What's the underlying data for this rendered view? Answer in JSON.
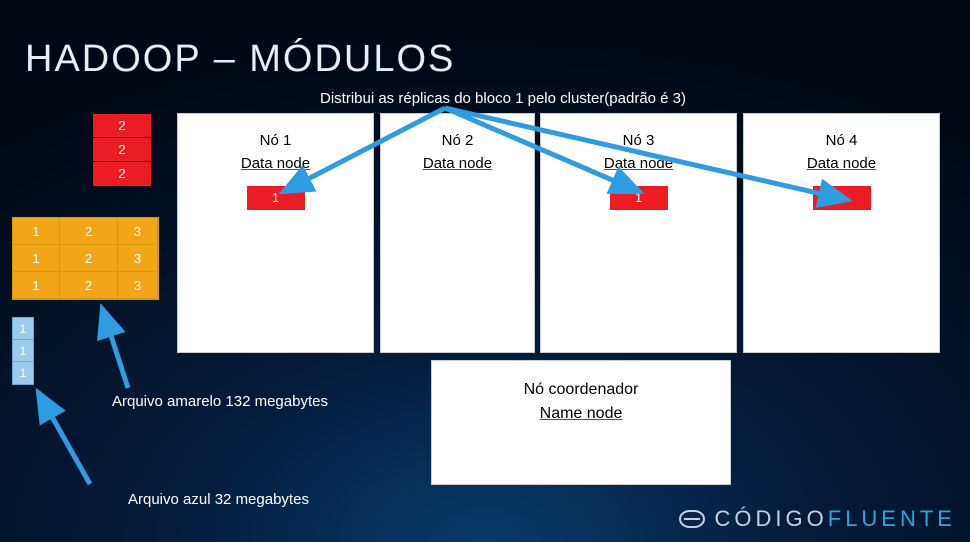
{
  "title": "HADOOP – MÓDULOS",
  "distribution_caption": "Distribui as réplicas do bloco 1 pelo cluster(padrão é 3)",
  "red_table": {
    "values": [
      "2",
      "2",
      "2"
    ]
  },
  "yellow_table": {
    "rows": [
      [
        "1",
        "2",
        "3"
      ],
      [
        "1",
        "2",
        "3"
      ],
      [
        "1",
        "2",
        "3"
      ]
    ]
  },
  "blue_col": {
    "values": [
      "1",
      "1",
      "1"
    ]
  },
  "yellow_caption": "Arquivo amarelo 132 megabytes",
  "blue_caption": "Arquivo azul 32 megabytes",
  "nodes": [
    {
      "name": "Nó 1",
      "type": "Data node",
      "has_block1": true
    },
    {
      "name": "Nó 2",
      "type": "Data node",
      "has_block1": false
    },
    {
      "name": "Nó 3",
      "type": "Data node",
      "has_block1": true
    },
    {
      "name": "Nó 4",
      "type": "Data node",
      "has_block1": true
    }
  ],
  "block1_label": "1",
  "coordinator": {
    "name": "Nó coordenador",
    "type": "Name node"
  },
  "logo": {
    "prefix": "CÓDIGO",
    "accent": "FLUENTE"
  },
  "colors": {
    "red": "#ec1c24",
    "yellow": "#f3a51a",
    "blue": "#9dcbea",
    "arrow": "#2f9be0"
  }
}
